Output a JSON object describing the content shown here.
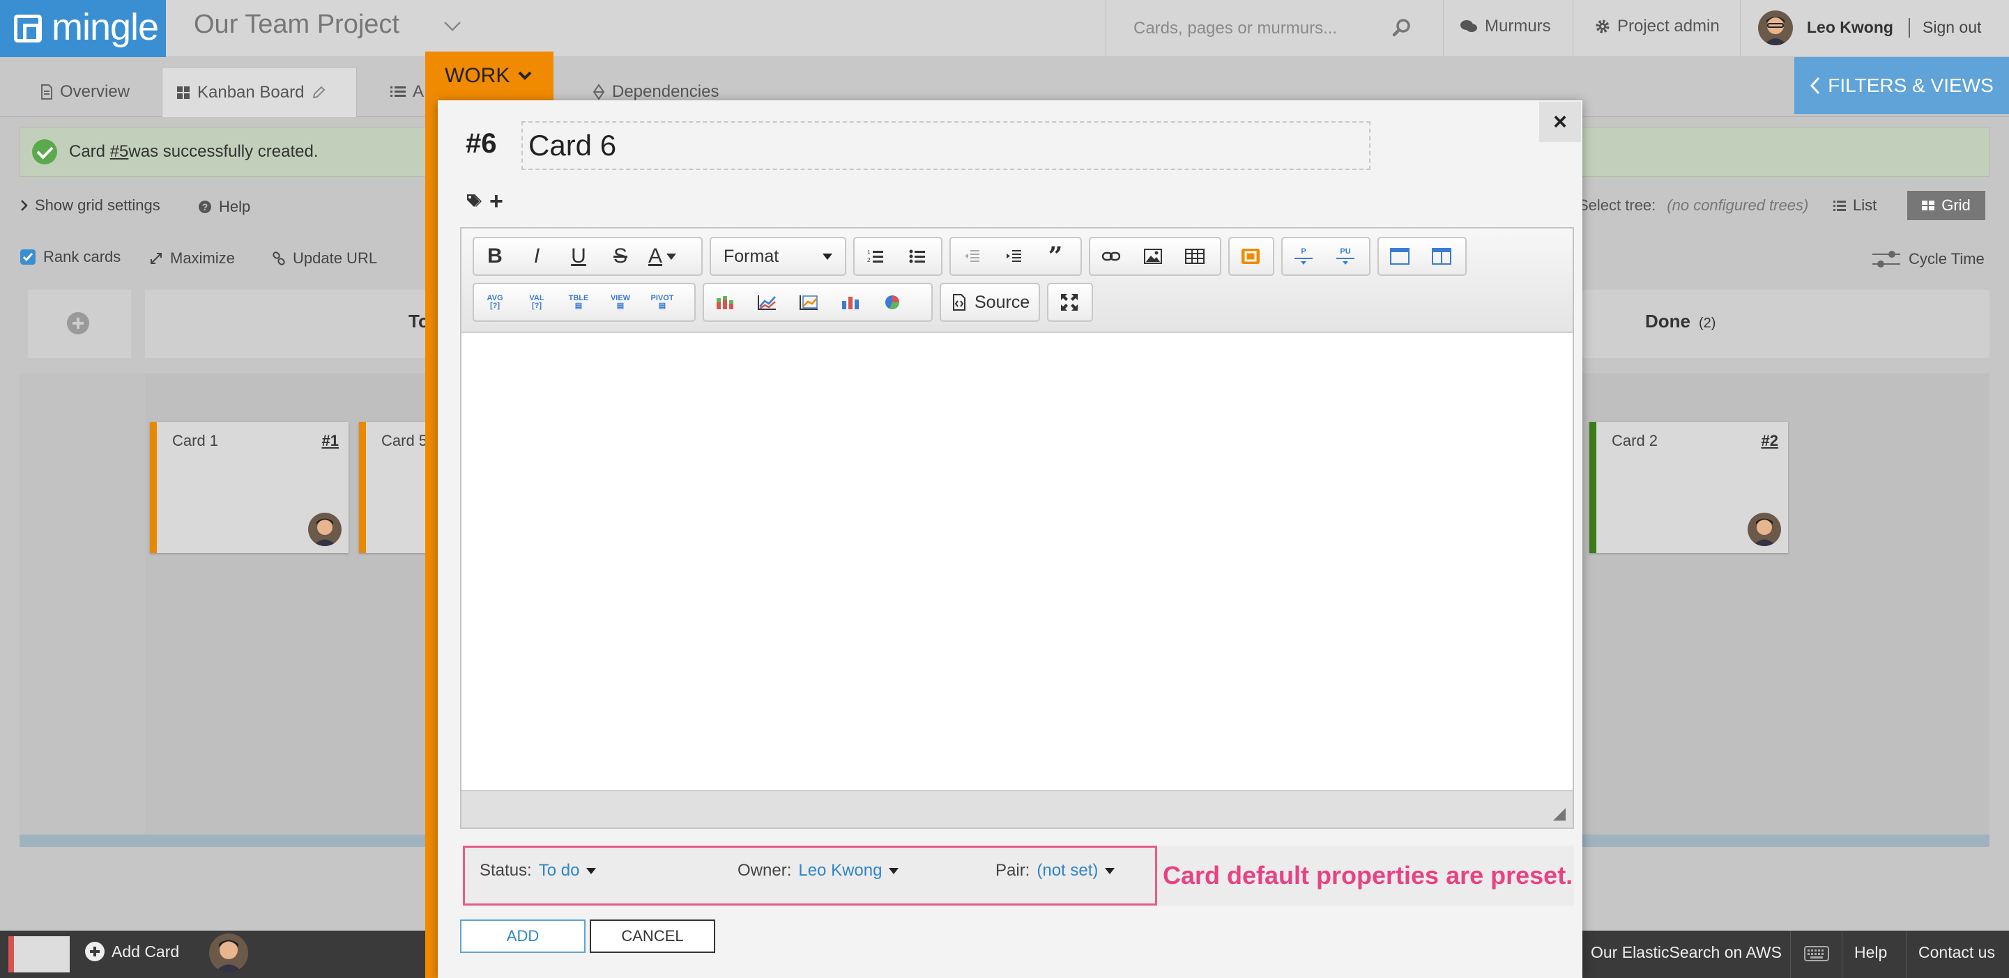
{
  "app": {
    "brand": "mingle",
    "project_name": "Our Team Project"
  },
  "header": {
    "search_placeholder": "Cards, pages or murmurs...",
    "murmurs": "Murmurs",
    "project_admin": "Project admin",
    "user_name": "Leo Kwong",
    "sign_out": "Sign out"
  },
  "tabs": [
    {
      "label": "Overview"
    },
    {
      "label": "Kanban Board",
      "active": true
    },
    {
      "label": "A"
    },
    {
      "label": "Dependencies"
    }
  ],
  "filters_views": "FILTERS & VIEWS",
  "flash": {
    "prefix": "Card ",
    "link": "#5",
    "suffix": " was successfully created."
  },
  "grid": {
    "show_grid_settings": "Show grid settings",
    "help": "Help",
    "rank_cards": "Rank cards",
    "rank_cards_checked": true,
    "maximize": "Maximize",
    "update_url": "Update URL",
    "select_tree": "Select tree:",
    "no_trees": "(no configured trees)",
    "list": "List",
    "grid": "Grid",
    "cycle_time": "Cycle Time"
  },
  "columns": {
    "todo": {
      "title": "To"
    },
    "done": {
      "title": "Done",
      "count": "(2)"
    }
  },
  "cards": [
    {
      "title": "Card 1",
      "number": "#1"
    },
    {
      "title": "Card 5",
      "number": ""
    },
    {
      "title": "Card 2",
      "number": "#2"
    }
  ],
  "modal": {
    "card_type": "WORK",
    "card_number": "#6",
    "card_title": "Card 6",
    "close": "×",
    "toolbar": {
      "format": "Format",
      "source": "Source"
    },
    "properties": {
      "status_label": "Status:",
      "status_value": "To do",
      "owner_label": "Owner:",
      "owner_value": "Leo Kwong",
      "pair_label": "Pair:",
      "pair_value": "(not set)"
    },
    "callout": "Card default properties are preset.",
    "add_button": "ADD",
    "cancel_button": "CANCEL"
  },
  "bottombar": {
    "add_card": "Add Card",
    "elastic": "Our ElasticSearch on AWS",
    "help": "Help",
    "contact_us": "Contact us"
  },
  "colors": {
    "brand": "#3a8fd2",
    "work_stripe": "#f08a00",
    "callout": "#e74384",
    "link": "#2f86c9",
    "done_border": "#3a7d1a"
  }
}
